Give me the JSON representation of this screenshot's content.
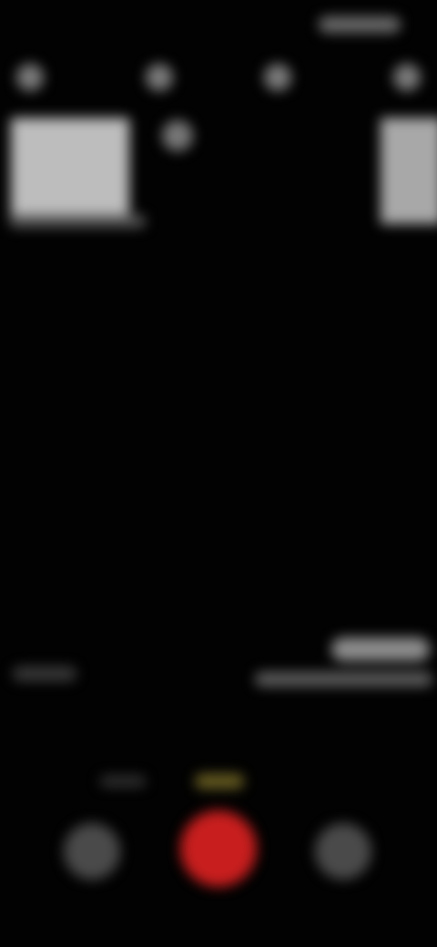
{
  "screen": {
    "state": "blurred",
    "background_color": "#020202"
  },
  "controls": {
    "record_button_color": "#c81e1e"
  }
}
